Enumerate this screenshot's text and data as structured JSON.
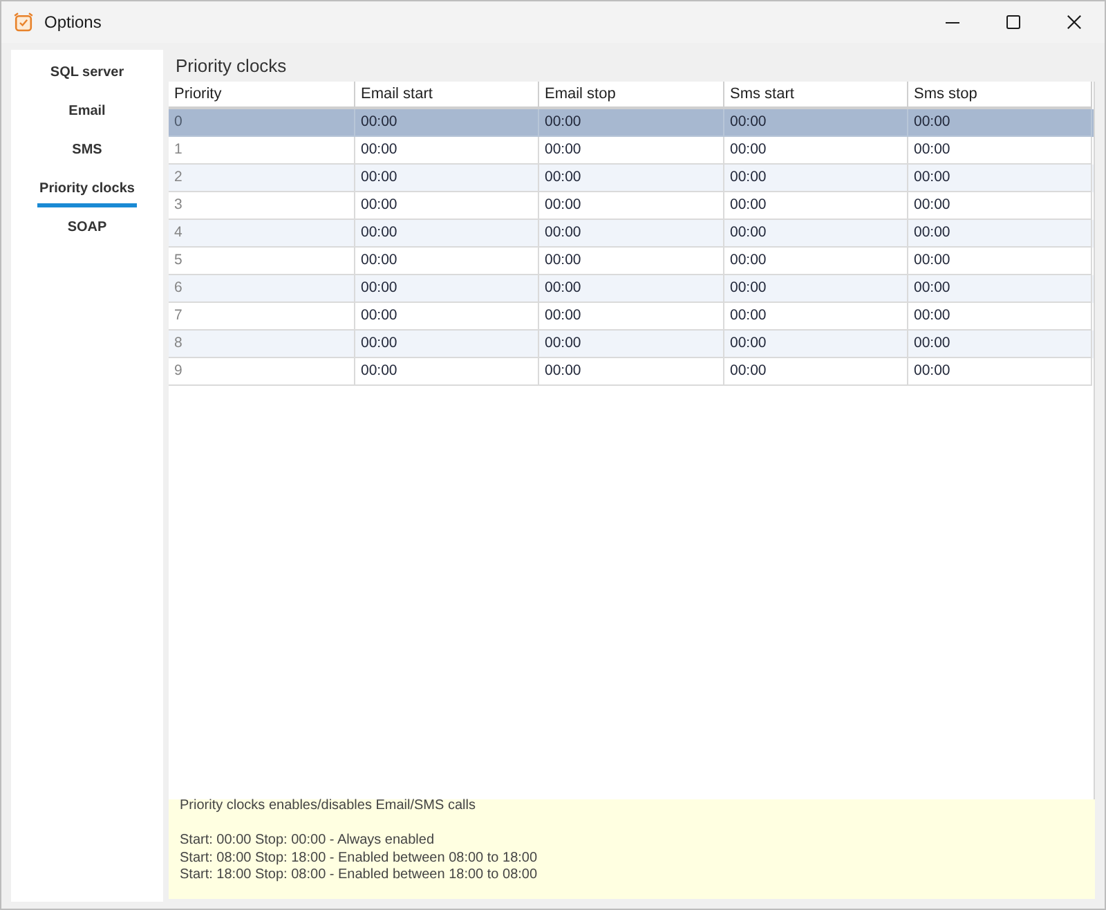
{
  "window": {
    "title": "Options"
  },
  "sidebar": {
    "items": [
      {
        "label": "SQL server",
        "selected": false
      },
      {
        "label": "Email",
        "selected": false
      },
      {
        "label": "SMS",
        "selected": false
      },
      {
        "label": "Priority clocks",
        "selected": true
      },
      {
        "label": "SOAP",
        "selected": false
      }
    ]
  },
  "priority_clocks": {
    "title": "Priority clocks",
    "table": {
      "columns": [
        "Priority",
        "Email start",
        "Email stop",
        "Sms start",
        "Sms stop"
      ],
      "rows": [
        {
          "cells": [
            "0",
            "00:00",
            "00:00",
            "00:00",
            "00:00"
          ],
          "selected": true
        },
        {
          "cells": [
            "1",
            "00:00",
            "00:00",
            "00:00",
            "00:00"
          ],
          "selected": false
        },
        {
          "cells": [
            "2",
            "00:00",
            "00:00",
            "00:00",
            "00:00"
          ],
          "selected": false
        },
        {
          "cells": [
            "3",
            "00:00",
            "00:00",
            "00:00",
            "00:00"
          ],
          "selected": false
        },
        {
          "cells": [
            "4",
            "00:00",
            "00:00",
            "00:00",
            "00:00"
          ],
          "selected": false
        },
        {
          "cells": [
            "5",
            "00:00",
            "00:00",
            "00:00",
            "00:00"
          ],
          "selected": false
        },
        {
          "cells": [
            "6",
            "00:00",
            "00:00",
            "00:00",
            "00:00"
          ],
          "selected": false
        },
        {
          "cells": [
            "7",
            "00:00",
            "00:00",
            "00:00",
            "00:00"
          ],
          "selected": false
        },
        {
          "cells": [
            "8",
            "00:00",
            "00:00",
            "00:00",
            "00:00"
          ],
          "selected": false
        },
        {
          "cells": [
            "9",
            "00:00",
            "00:00",
            "00:00",
            "00:00"
          ],
          "selected": false
        }
      ]
    },
    "info": {
      "heading": "Priority clocks enables/disables Email/SMS calls",
      "lines": [
        "Start: 00:00 Stop: 00:00 - Always enabled",
        "Start: 08:00 Stop: 18:00 - Enabled between 08:00 to 18:00",
        "Start: 18:00 Stop: 08:00 - Enabled between 18:00 to 08:00"
      ]
    }
  }
}
